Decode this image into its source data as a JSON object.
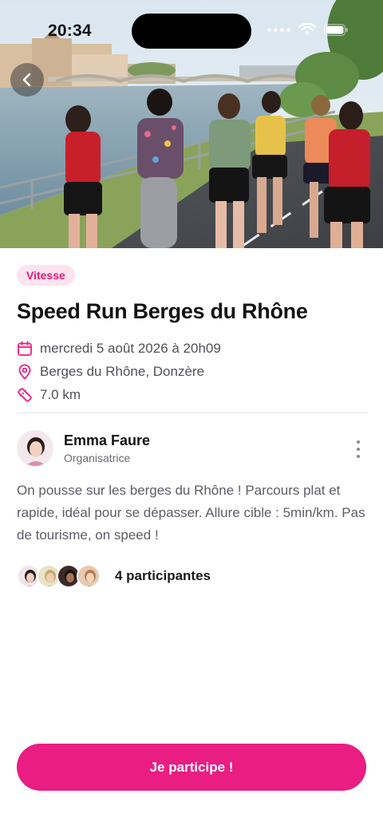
{
  "status_bar": {
    "time": "20:34",
    "icons": [
      "cellular-icon",
      "wifi-icon",
      "battery-icon"
    ]
  },
  "nav": {
    "back_icon": "chevron-left-icon"
  },
  "hero": {
    "image": "group-of-women-running-along-river-quay"
  },
  "event": {
    "tag": "Vitesse",
    "title": "Speed Run Berges du Rhône",
    "date": "mercredi 5 août 2026 à 20h09",
    "location": "Berges du Rhône, Donzère",
    "distance": "7.0 km"
  },
  "organizer": {
    "name": "Emma Faure",
    "role": "Organisatrice",
    "menu_icon": "more-vertical-icon"
  },
  "description": "On pousse sur les berges du Rhône ! Parcours plat et rapide, idéal pour se dépasser. Allure cible : 5min/km. Pas de tourisme, on speed !",
  "participants": {
    "count_label": "4 participantes",
    "avatar_count": 4
  },
  "cta": {
    "label": "Je participe !"
  },
  "colors": {
    "accent": "#e91d82",
    "tag_bg": "#fde3ef",
    "text_primary": "#141414",
    "text_secondary": "#5d5d66"
  }
}
